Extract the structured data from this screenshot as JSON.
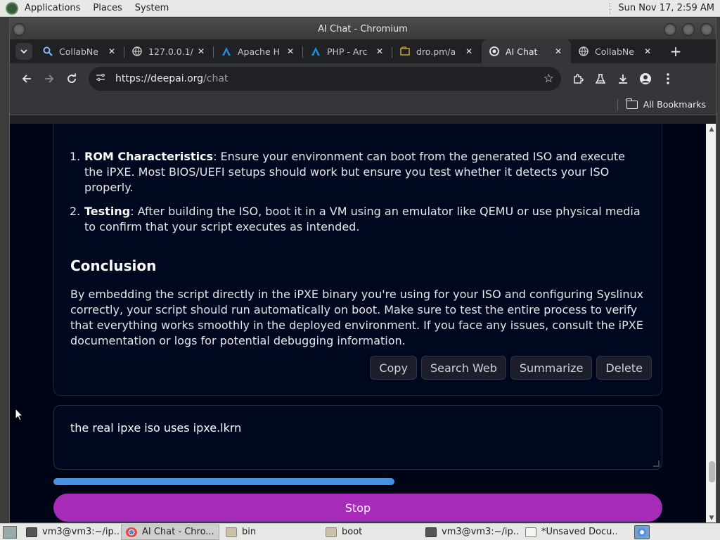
{
  "top_panel": {
    "menus": [
      "Applications",
      "Places",
      "System"
    ],
    "clock": "Sun Nov 17,  2:59 AM"
  },
  "window": {
    "title": "AI Chat - Chromium"
  },
  "tabs": [
    {
      "title": "CollabNe",
      "icon": "search-icon",
      "active": false
    },
    {
      "title": "127.0.0.1/",
      "icon": "globe-icon",
      "active": false
    },
    {
      "title": "Apache H",
      "icon": "triangle-logo-icon",
      "active": false
    },
    {
      "title": "PHP - Arc",
      "icon": "triangle-logo-icon",
      "active": false
    },
    {
      "title": "dro.pm/a",
      "icon": "file-icon",
      "active": false
    },
    {
      "title": "AI Chat",
      "icon": "deepai-icon",
      "active": true
    },
    {
      "title": "CollabNe",
      "icon": "globe-icon",
      "active": false
    }
  ],
  "toolbar": {
    "url_host": "https://deepai.org",
    "url_path": "/chat"
  },
  "bookmarks": {
    "all_bookmarks": "All Bookmarks"
  },
  "content": {
    "list": [
      {
        "num": "1.",
        "bold": "ROM Characteristics",
        "text": ": Ensure your environment can boot from the generated ISO and execute the iPXE. Most BIOS/UEFI setups should work but ensure you test whether it detects your ISO properly."
      },
      {
        "num": "2.",
        "bold": "Testing",
        "text": ": After building the ISO, boot it in a VM using an emulator like QEMU or use physical media to confirm that your script executes as intended."
      }
    ],
    "conclusion_heading": "Conclusion",
    "conclusion_body": "By embedding the script directly in the iPXE binary you're using for your ISO and configuring Syslinux correctly, your script should run automatically on boot. Make sure to test the entire process to verify that everything works smoothly in the deployed environment. If you face any issues, consult the iPXE documentation or logs for potential debugging information.",
    "actions": {
      "copy": "Copy",
      "search_web": "Search Web",
      "summarize": "Summarize",
      "delete": "Delete"
    }
  },
  "chat": {
    "input_text": "the real ipxe iso uses ipxe.lkrn",
    "progress_fraction": 0.56,
    "stop_label": "Stop"
  },
  "taskbar": {
    "tasks": [
      {
        "label": "vm3@vm3:~/ip...",
        "icon": "terminal-icon",
        "active": false
      },
      {
        "label": "AI Chat - Chro...",
        "icon": "chromium-icon",
        "active": true
      },
      {
        "label": "bin",
        "icon": "folder-icon",
        "active": false
      },
      {
        "label": "boot",
        "icon": "folder-icon",
        "active": false
      },
      {
        "label": "vm3@vm3:~/ip...",
        "icon": "terminal-icon",
        "active": false
      },
      {
        "label": "*Unsaved Docu...",
        "icon": "text-editor-icon",
        "active": false
      }
    ]
  }
}
